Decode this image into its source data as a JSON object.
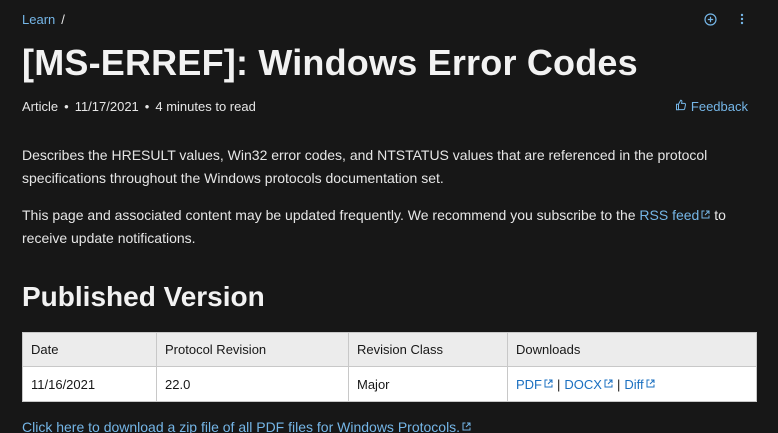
{
  "breadcrumb": {
    "root": "Learn",
    "separator": "/"
  },
  "title": "[MS-ERREF]: Windows Error Codes",
  "meta": {
    "type": "Article",
    "date": "11/17/2021",
    "read_time": "4 minutes to read",
    "feedback": "Feedback"
  },
  "body": {
    "p1": "Describes the HRESULT values, Win32 error codes, and NTSTATUS values that are referenced in the protocol specifications throughout the Windows protocols documentation set.",
    "p2_before": "This page and associated content may be updated frequently. We recommend you subscribe to the",
    "p2_link": "RSS feed",
    "p2_after": "to receive update notifications."
  },
  "section_title": "Published Version",
  "table": {
    "headers": [
      "Date",
      "Protocol Revision",
      "Revision Class",
      "Downloads"
    ],
    "row": {
      "date": "11/16/2021",
      "revision": "22.0",
      "class": "Major",
      "downloads": [
        "PDF",
        "DOCX",
        "Diff"
      ],
      "download_separator": "|"
    }
  },
  "zip_link": "Click here to download a zip file of all PDF files for Windows Protocols.",
  "icons": {
    "add": "plus-circle-icon",
    "more": "more-vertical-icon",
    "feedback": "thumbs-up-icon",
    "external": "external-link-icon"
  },
  "colors": {
    "background": "#171717",
    "link": "#75b6e7",
    "table_link": "#1a6fc0"
  }
}
